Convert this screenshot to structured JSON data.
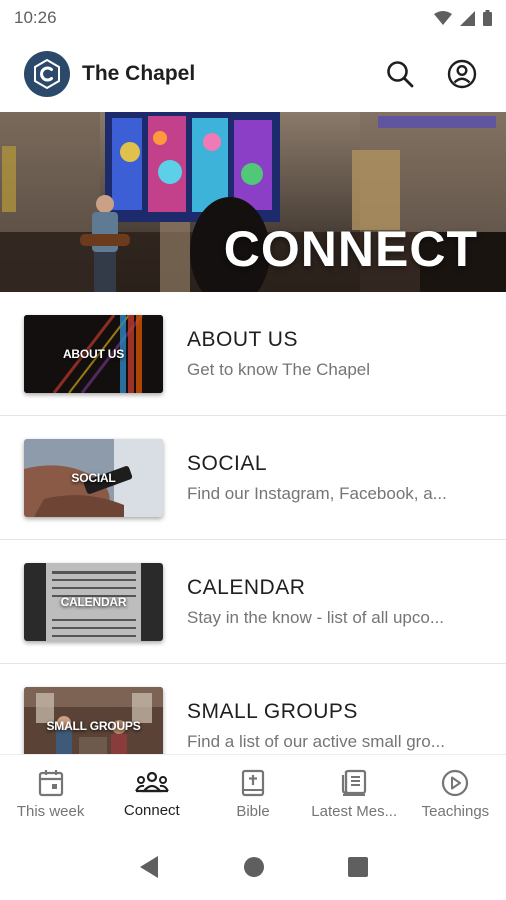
{
  "status_bar": {
    "time": "10:26"
  },
  "app": {
    "title": "The Chapel"
  },
  "hero": {
    "title": "CONNECT"
  },
  "items": [
    {
      "thumb_label": "ABOUT US",
      "title": "ABOUT US",
      "subtitle": "Get to know The Chapel"
    },
    {
      "thumb_label": "SOCIAL",
      "title": "SOCIAL",
      "subtitle": "Find our Instagram, Facebook, a..."
    },
    {
      "thumb_label": "CALENDAR",
      "title": "CALENDAR",
      "subtitle": "Stay in the know - list of all upco..."
    },
    {
      "thumb_label": "SMALL GROUPS",
      "title": "SMALL GROUPS",
      "subtitle": "Find a list of our active small gro..."
    }
  ],
  "bottom_nav": [
    {
      "label": "This week",
      "icon": "calendar-icon"
    },
    {
      "label": "Connect",
      "icon": "people-icon",
      "active": true
    },
    {
      "label": "Bible",
      "icon": "bible-icon"
    },
    {
      "label": "Latest Mes...",
      "icon": "book-icon"
    },
    {
      "label": "Teachings",
      "icon": "play-circle-icon"
    }
  ],
  "colors": {
    "brand": "#2b4a6b",
    "text": "#1f1f1f",
    "muted": "#757575"
  }
}
